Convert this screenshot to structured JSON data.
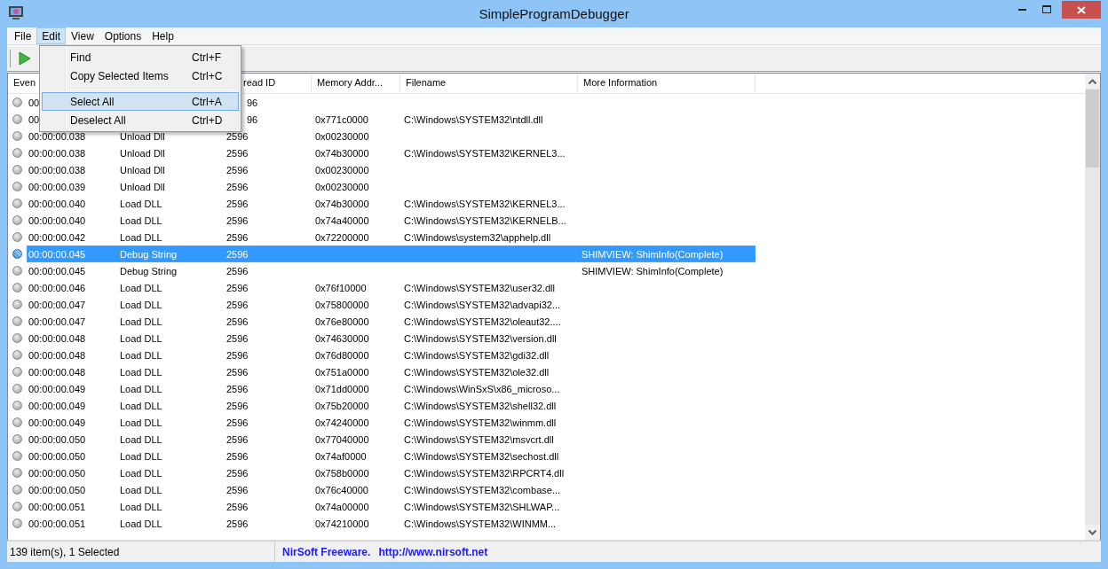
{
  "window": {
    "title": "SimpleProgramDebugger"
  },
  "menu_bar": [
    {
      "label": "File",
      "selected": false
    },
    {
      "label": "Edit",
      "selected": true
    },
    {
      "label": "View",
      "selected": false
    },
    {
      "label": "Options",
      "selected": false
    },
    {
      "label": "Help",
      "selected": false
    }
  ],
  "edit_menu": [
    {
      "kind": "item",
      "label": "Find",
      "shortcut": "Ctrl+F",
      "selected": false
    },
    {
      "kind": "item",
      "label": "Copy Selected Items",
      "shortcut": "Ctrl+C",
      "selected": false
    },
    {
      "kind": "separator"
    },
    {
      "kind": "item",
      "label": "Select All",
      "shortcut": "Ctrl+A",
      "selected": true
    },
    {
      "kind": "item",
      "label": "Deselect All",
      "shortcut": "Ctrl+D",
      "selected": false
    }
  ],
  "table": {
    "columns": [
      {
        "label": "Even"
      },
      {
        "label": "read ID",
        "covered": true
      },
      {
        "label": "Memory Addr..."
      },
      {
        "label": "Filename"
      },
      {
        "label": "More Information"
      }
    ],
    "rows": [
      {
        "time": "00",
        "thread": "96",
        "covered": true,
        "selected": false
      },
      {
        "time": "00",
        "thread": "96",
        "address": "0x771c0000",
        "file": "C:\\Windows\\SYSTEM32\\ntdll.dll",
        "covered": true,
        "selected": false
      },
      {
        "time": "00:00:00.038",
        "type": "Unload Dll",
        "thread": "2596",
        "address": "0x00230000",
        "selected": false
      },
      {
        "time": "00:00:00.038",
        "type": "Unload Dll",
        "thread": "2596",
        "address": "0x74b30000",
        "file": "C:\\Windows\\SYSTEM32\\KERNEL3...",
        "selected": false
      },
      {
        "time": "00:00:00.038",
        "type": "Unload Dll",
        "thread": "2596",
        "address": "0x00230000",
        "selected": false
      },
      {
        "time": "00:00:00.039",
        "type": "Unload Dll",
        "thread": "2596",
        "address": "0x00230000",
        "selected": false
      },
      {
        "time": "00:00:00.040",
        "type": "Load DLL",
        "thread": "2596",
        "address": "0x74b30000",
        "file": "C:\\Windows\\SYSTEM32\\KERNEL3...",
        "selected": false
      },
      {
        "time": "00:00:00.040",
        "type": "Load DLL",
        "thread": "2596",
        "address": "0x74a40000",
        "file": "C:\\Windows\\SYSTEM32\\KERNELB...",
        "selected": false
      },
      {
        "time": "00:00:00.042",
        "type": "Load DLL",
        "thread": "2596",
        "address": "0x72200000",
        "file": "C:\\Windows\\system32\\apphelp.dll",
        "selected": false
      },
      {
        "time": "00:00:00.045",
        "type": "Debug String",
        "thread": "2596",
        "info": "SHIMVIEW: ShimInfo(Complete)",
        "selected": true
      },
      {
        "time": "00:00:00.045",
        "type": "Debug String",
        "thread": "2596",
        "info": "SHIMVIEW: ShimInfo(Complete)",
        "selected": false
      },
      {
        "time": "00:00:00.046",
        "type": "Load DLL",
        "thread": "2596",
        "address": "0x76f10000",
        "file": "C:\\Windows\\SYSTEM32\\user32.dll",
        "selected": false
      },
      {
        "time": "00:00:00.047",
        "type": "Load DLL",
        "thread": "2596",
        "address": "0x75800000",
        "file": "C:\\Windows\\SYSTEM32\\advapi32...",
        "selected": false
      },
      {
        "time": "00:00:00.047",
        "type": "Load DLL",
        "thread": "2596",
        "address": "0x76e80000",
        "file": "C:\\Windows\\SYSTEM32\\oleaut32....",
        "selected": false
      },
      {
        "time": "00:00:00.048",
        "type": "Load DLL",
        "thread": "2596",
        "address": "0x74630000",
        "file": "C:\\Windows\\SYSTEM32\\version.dll",
        "selected": false
      },
      {
        "time": "00:00:00.048",
        "type": "Load DLL",
        "thread": "2596",
        "address": "0x76d80000",
        "file": "C:\\Windows\\SYSTEM32\\gdi32.dll",
        "selected": false
      },
      {
        "time": "00:00:00.048",
        "type": "Load DLL",
        "thread": "2596",
        "address": "0x751a0000",
        "file": "C:\\Windows\\SYSTEM32\\ole32.dll",
        "selected": false
      },
      {
        "time": "00:00:00.049",
        "type": "Load DLL",
        "thread": "2596",
        "address": "0x71dd0000",
        "file": "C:\\Windows\\WinSxS\\x86_microso...",
        "selected": false
      },
      {
        "time": "00:00:00.049",
        "type": "Load DLL",
        "thread": "2596",
        "address": "0x75b20000",
        "file": "C:\\Windows\\SYSTEM32\\shell32.dll",
        "selected": false
      },
      {
        "time": "00:00:00.049",
        "type": "Load DLL",
        "thread": "2596",
        "address": "0x74240000",
        "file": "C:\\Windows\\SYSTEM32\\winmm.dll",
        "selected": false
      },
      {
        "time": "00:00:00.050",
        "type": "Load DLL",
        "thread": "2596",
        "address": "0x77040000",
        "file": "C:\\Windows\\SYSTEM32\\msvcrt.dll",
        "selected": false
      },
      {
        "time": "00:00:00.050",
        "type": "Load DLL",
        "thread": "2596",
        "address": "0x74af0000",
        "file": "C:\\Windows\\SYSTEM32\\sechost.dll",
        "selected": false
      },
      {
        "time": "00:00:00.050",
        "type": "Load DLL",
        "thread": "2596",
        "address": "0x758b0000",
        "file": "C:\\Windows\\SYSTEM32\\RPCRT4.dll",
        "selected": false
      },
      {
        "time": "00:00:00.050",
        "type": "Load DLL",
        "thread": "2596",
        "address": "0x76c40000",
        "file": "C:\\Windows\\SYSTEM32\\combase...",
        "selected": false
      },
      {
        "time": "00:00:00.051",
        "type": "Load DLL",
        "thread": "2596",
        "address": "0x74a00000",
        "file": "C:\\Windows\\SYSTEM32\\SHLWAP...",
        "selected": false
      },
      {
        "time": "00:00:00.051",
        "type": "Load DLL",
        "thread": "2596",
        "address": "0x74210000",
        "file": "C:\\Windows\\SYSTEM32\\WINMM...",
        "selected": false
      }
    ]
  },
  "status_bar": {
    "count": "139 item(s), 1 Selected",
    "credit": "NirSoft Freeware.",
    "link": "http://www.nirsoft.net"
  }
}
